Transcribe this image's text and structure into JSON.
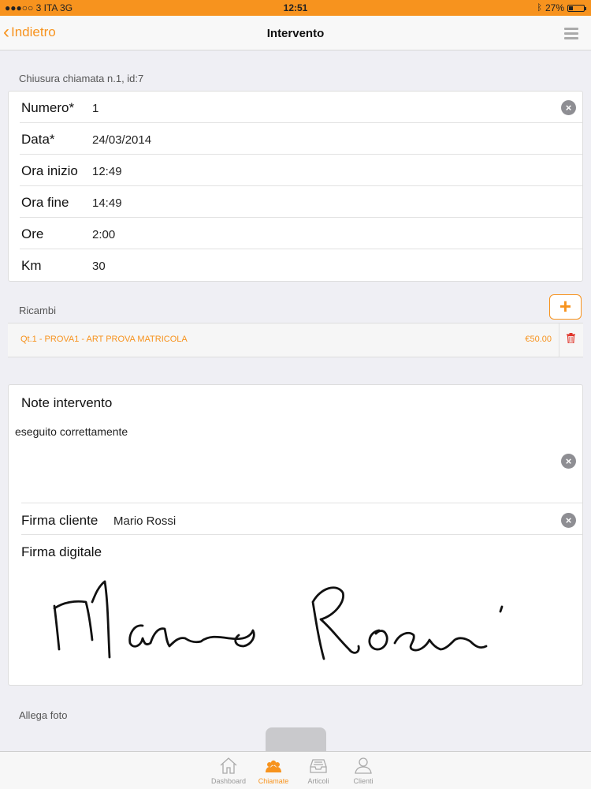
{
  "status_bar": {
    "carrier": "●●●○○ 3 ITA  3G",
    "time": "12:51",
    "battery_text": "27%",
    "battery_level": 0.27
  },
  "nav": {
    "back_label": "Indietro",
    "title": "Intervento"
  },
  "section_closing": "Chiusura chiamata n.1, id:7",
  "fields": [
    {
      "label": "Numero*",
      "value": "1"
    },
    {
      "label": "Data*",
      "value": "24/03/2014"
    },
    {
      "label": "Ora inizio",
      "value": "12:49"
    },
    {
      "label": "Ora fine",
      "value": "14:49"
    },
    {
      "label": "Ore",
      "value": "2:00"
    },
    {
      "label": "Km",
      "value": "30"
    }
  ],
  "ricambi": {
    "label": "Ricambi",
    "add_label": "+",
    "items": [
      {
        "description": "Qt.1  - PROVA1  - ART PROVA MATRICOLA",
        "price": "€50.00"
      }
    ]
  },
  "notes": {
    "title": "Note intervento",
    "text": "eseguito correttamente"
  },
  "firma_cliente": {
    "label": "Firma cliente",
    "value": "Mario Rossi"
  },
  "firma_digitale": {
    "label": "Firma digitale"
  },
  "allega_foto": "Allega foto",
  "tabs": [
    {
      "label": "Dashboard",
      "icon": "home-icon",
      "active": false
    },
    {
      "label": "Chiamate",
      "icon": "people-icon",
      "active": true
    },
    {
      "label": "Articoli",
      "icon": "tray-icon",
      "active": false
    },
    {
      "label": "Clienti",
      "icon": "person-icon",
      "active": false
    }
  ],
  "colors": {
    "accent": "#f7931e",
    "delete": "#e0352b"
  }
}
